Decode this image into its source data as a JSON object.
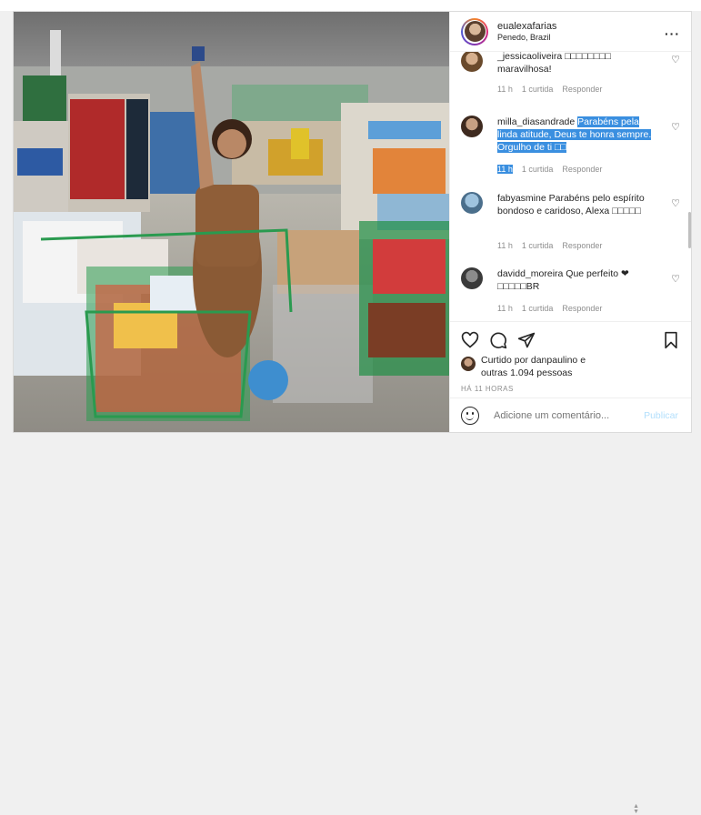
{
  "header": {
    "username": "eualexafarias",
    "location": "Penedo, Brazil",
    "more_icon": "more-horizontal-icon"
  },
  "comments": [
    {
      "username": "_jessicaoliveira",
      "text": "□□□□□□□□ maravilhosa!",
      "time": "11 h",
      "likes": "1 curtida",
      "reply": "Responder"
    },
    {
      "username": "milla_diasandrade",
      "text": "Parabéns pela linda atitude, Deus te honra sempre. Orgulho de ti □□",
      "time": "11 h",
      "likes": "1 curtida",
      "reply": "Responder"
    },
    {
      "username": "fabyasmine",
      "text": "Parabéns pelo espírito bondoso e caridoso, Alexa □□□□□",
      "time": "11 h",
      "likes": "1 curtida",
      "reply": "Responder"
    },
    {
      "username": "davidd_moreira",
      "text": "Que perfeito ❤ □□□□□BR",
      "time": "11 h",
      "likes": "1 curtida",
      "reply": "Responder"
    }
  ],
  "likes": {
    "prefix": "Curtido por",
    "user": "danpaulino",
    "middle": "e",
    "others": "outras 1.094 pessoas"
  },
  "timestamp": "HÁ 11 HORAS",
  "comment_box": {
    "placeholder": "Adicione um comentário...",
    "publish": "Publicar"
  },
  "colors": {
    "selection": "#3a8fe0",
    "publish_disabled": "#b2dffc",
    "muted": "#8e8e8e"
  }
}
